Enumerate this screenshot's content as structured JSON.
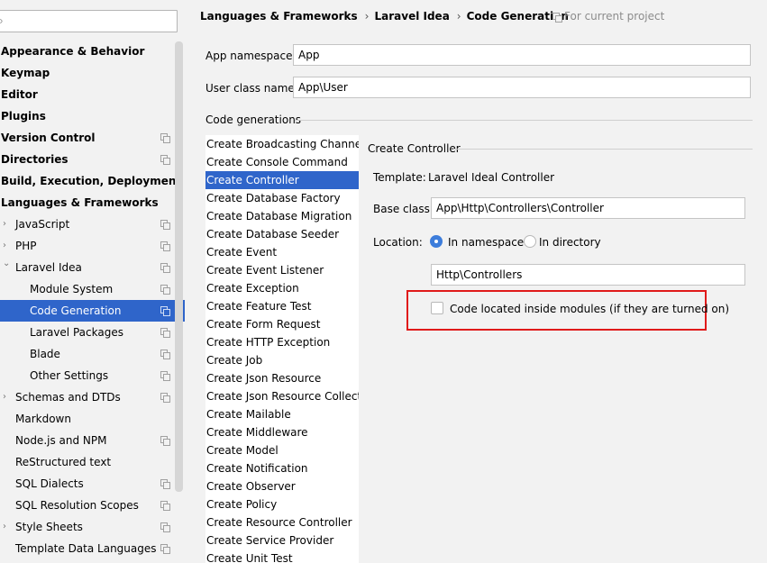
{
  "search": {
    "value": ""
  },
  "sidebar": {
    "items": [
      {
        "label": "Appearance & Behavior",
        "bold": true
      },
      {
        "label": "Keymap",
        "bold": true
      },
      {
        "label": "Editor",
        "bold": true
      },
      {
        "label": "Plugins",
        "bold": true
      },
      {
        "label": "Version Control",
        "bold": true,
        "project": true
      },
      {
        "label": "Directories",
        "bold": true,
        "project": true
      },
      {
        "label": "Build, Execution, Deployment",
        "bold": true
      },
      {
        "label": "Languages & Frameworks",
        "bold": true
      },
      {
        "label": "JavaScript",
        "level": 1,
        "arrow": "collapsed",
        "project": true
      },
      {
        "label": "PHP",
        "level": 1,
        "arrow": "collapsed",
        "project": true
      },
      {
        "label": "Laravel Idea",
        "level": 1,
        "arrow": "expanded",
        "project": true
      },
      {
        "label": "Module System",
        "level": 2,
        "project": true
      },
      {
        "label": "Code Generation",
        "level": 2,
        "project": true,
        "selected": true
      },
      {
        "label": "Laravel Packages",
        "level": 2,
        "project": true
      },
      {
        "label": "Blade",
        "level": 2,
        "project": true
      },
      {
        "label": "Other Settings",
        "level": 2,
        "project": true
      },
      {
        "label": "Schemas and DTDs",
        "level": 1,
        "arrow": "collapsed",
        "project": true
      },
      {
        "label": "Markdown",
        "level": 1
      },
      {
        "label": "Node.js and NPM",
        "level": 1,
        "project": true
      },
      {
        "label": "ReStructured text",
        "level": 1
      },
      {
        "label": "SQL Dialects",
        "level": 1,
        "project": true
      },
      {
        "label": "SQL Resolution Scopes",
        "level": 1,
        "project": true
      },
      {
        "label": "Style Sheets",
        "level": 1,
        "arrow": "collapsed",
        "project": true
      },
      {
        "label": "Template Data Languages",
        "level": 1,
        "project": true
      }
    ]
  },
  "breadcrumb": {
    "items": [
      "Languages & Frameworks",
      "Laravel Idea",
      "Code Generation"
    ],
    "separator": "›",
    "scope": "For current project"
  },
  "form": {
    "app_namespace_label": "App namespace:",
    "app_namespace_value": "App",
    "user_class_label": "User class name:",
    "user_class_value": "App\\User"
  },
  "code_generations": {
    "title": "Code generations",
    "items": [
      "Create Broadcasting Channel",
      "Create Console Command",
      "Create Controller",
      "Create Database Factory",
      "Create Database Migration",
      "Create Database Seeder",
      "Create Event",
      "Create Event Listener",
      "Create Exception",
      "Create Feature Test",
      "Create Form Request",
      "Create HTTP Exception",
      "Create Job",
      "Create Json Resource",
      "Create Json Resource Collection",
      "Create Mailable",
      "Create Middleware",
      "Create Model",
      "Create Notification",
      "Create Observer",
      "Create Policy",
      "Create Resource Controller",
      "Create Service Provider",
      "Create Unit Test"
    ],
    "selected_index": 2
  },
  "detail": {
    "title": "Create Controller",
    "template_label": "Template:",
    "template_value": "Laravel Ideal Controller",
    "base_class_label": "Base class:",
    "base_class_value": "App\\Http\\Controllers\\Controller",
    "location_label": "Location:",
    "radio_namespace": "In namespace",
    "radio_directory": "In directory",
    "location_selected": "In namespace",
    "namespace_value": "Http\\Controllers",
    "checkbox_label": "Code located inside modules (if they are turned on)",
    "checkbox_checked": false
  },
  "colors": {
    "selection": "#2f65ca",
    "highlight_border": "#e01a1a",
    "radio_on": "#3d7ddb"
  }
}
